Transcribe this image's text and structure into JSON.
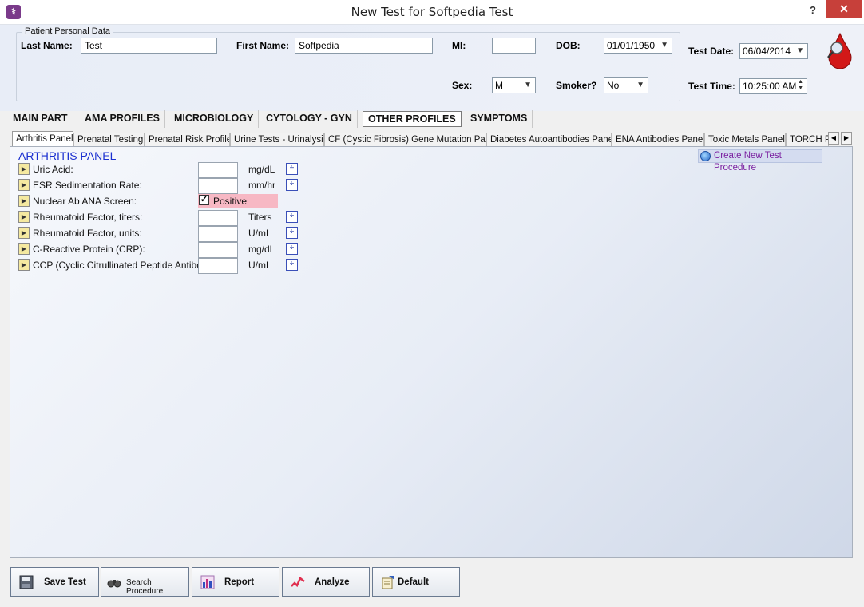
{
  "window": {
    "title": "New Test for Softpedia Test",
    "help_label": "?",
    "close_label": "✕",
    "app_icon_glyph": "⚕"
  },
  "patient": {
    "group_label": "Patient Personal Data",
    "last_name_label": "Last Name:",
    "last_name_value": "Test",
    "first_name_label": "First Name:",
    "first_name_value": "Softpedia",
    "mi_label": "MI:",
    "mi_value": "",
    "dob_label": "DOB:",
    "dob_value": "01/01/1950",
    "sex_label": "Sex:",
    "sex_value": "M",
    "smoker_label": "Smoker?",
    "smoker_value": "No",
    "test_date_label": "Test Date:",
    "test_date_value": "06/04/2014",
    "test_time_label": "Test Time:",
    "test_time_value": "10:25:00 AM"
  },
  "main_tabs": [
    {
      "label": "MAIN PART"
    },
    {
      "label": "AMA PROFILES"
    },
    {
      "label": "MICROBIOLOGY"
    },
    {
      "label": "CYTOLOGY - GYN"
    },
    {
      "label": "OTHER PROFILES",
      "active": true
    },
    {
      "label": "SYMPTOMS"
    }
  ],
  "sub_tabs": [
    {
      "label": "Arthritis Panel",
      "active": true
    },
    {
      "label": "Prenatal Testing"
    },
    {
      "label": "Prenatal Risk Profile"
    },
    {
      "label": "Urine Tests - Urinalysis"
    },
    {
      "label": "CF (Cystic Fibrosis) Gene Mutation Panel"
    },
    {
      "label": "Diabetes Autoantibodies Panel"
    },
    {
      "label": "ENA Antibodies Panel"
    },
    {
      "label": "Toxic Metals Panel"
    },
    {
      "label": "TORCH P"
    }
  ],
  "panel": {
    "title": "ARTHRITIS PANEL",
    "create_procedure_label": "Create New Test Procedure",
    "rows": [
      {
        "label": "Uric Acid:",
        "unit": "mg/dL",
        "value": ""
      },
      {
        "label": "ESR Sedimentation Rate:",
        "unit": "mm/hr",
        "value": ""
      },
      {
        "label": "Nuclear Ab ANA Screen:",
        "checkbox_label": "Positive",
        "checked": true
      },
      {
        "label": "Rheumatoid Factor, titers:",
        "unit": "Titers",
        "value": ""
      },
      {
        "label": "Rheumatoid Factor, units:",
        "unit": "U/mL",
        "value": ""
      },
      {
        "label": "C-Reactive Protein (CRP):",
        "unit": "mg/dL",
        "value": ""
      },
      {
        "label": "CCP (Cyclic Citrullinated Peptide Antibody):",
        "unit": "U/mL",
        "value": ""
      }
    ]
  },
  "toolbar": {
    "save_label": "Save Test",
    "search_label": "Search Procedure",
    "report_label": "Report",
    "analyze_label": "Analyze",
    "default_label": "Default"
  },
  "colors": {
    "close_button": "#c7403a",
    "link_blue": "#1a2fd0",
    "procedure_purple": "#7a1fa0",
    "positive_highlight": "#f7b8c4"
  }
}
